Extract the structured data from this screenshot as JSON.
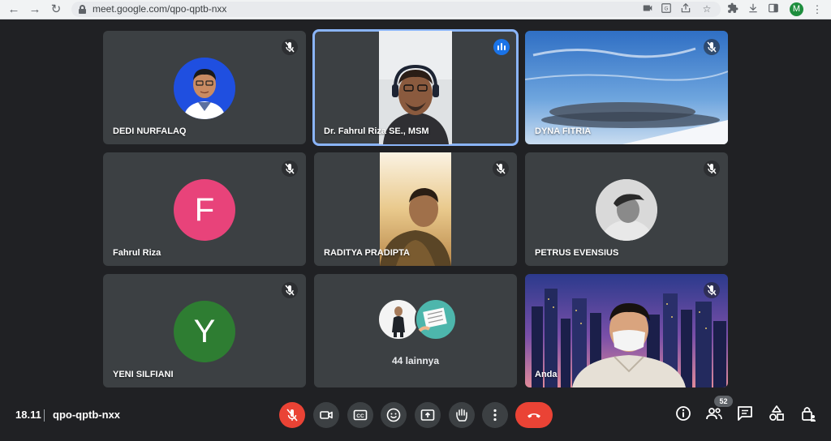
{
  "browser": {
    "url": "meet.google.com/qpo-qptb-nxx",
    "profile_initial": "M"
  },
  "tiles": [
    {
      "name": "DEDI NURFALAQ",
      "muted": true
    },
    {
      "name": "Dr. Fahrul Riza SE., MSM",
      "speaking": true
    },
    {
      "name": "DYNA FITRIA",
      "muted": true
    },
    {
      "name": "Fahrul Riza",
      "initial": "F",
      "avatar_color": "#e8437a",
      "muted": true
    },
    {
      "name": "RADITYA PRADIPTA",
      "muted": true
    },
    {
      "name": "PETRUS EVENSIUS",
      "muted": true
    },
    {
      "name": "YENI SILFIANI",
      "initial": "Y",
      "avatar_color": "#2e7d32",
      "muted": true
    },
    {
      "others_label": "44 lainnya"
    },
    {
      "name": "Anda",
      "muted": true
    }
  ],
  "bottom": {
    "time": "18.11",
    "meeting_code": "qpo-qptb-nxx",
    "participant_count": "52"
  },
  "colors": {
    "background": "#202124",
    "tile": "#3c4043",
    "accent": "#8ab4f8",
    "danger": "#ea4335"
  }
}
